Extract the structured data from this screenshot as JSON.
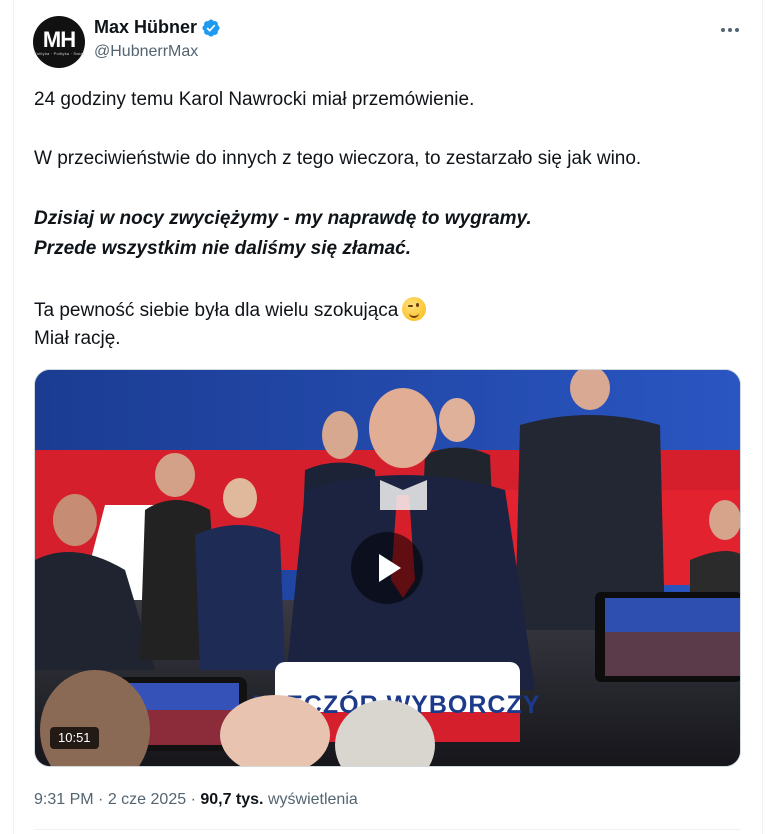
{
  "author": {
    "avatar_text": "MH",
    "avatar_subtext": "Polityka · Polityka · Świat",
    "name": "Max Hübner",
    "handle": "@HubnerrMax",
    "verified": true
  },
  "tweet": {
    "line1": "24 godziny temu Karol Nawrocki miał przemówienie.",
    "line2": "W przeciwieństwie do innych z tego wieczora, to zestarzało się jak wino.",
    "quote1": "Dzisiaj w nocy zwyciężymy - my naprawdę to wygramy.",
    "quote2": "Przede wszystkim nie daliśmy się złamać.",
    "line3": "Ta pewność siebie była dla wielu szokująca",
    "emoji": "winking-face",
    "line4": "Miał rację."
  },
  "media": {
    "duration": "10:51",
    "banner_text": "WIECZÓR WYBORCZY",
    "colors": {
      "stage_blue": "#1e3f94",
      "stage_red": "#d61f2c"
    }
  },
  "meta": {
    "time": "9:31 PM",
    "separator": "·",
    "date": "2 cze 2025",
    "views_count": "90,7 tys.",
    "views_label": "wyświetlenia"
  },
  "colors": {
    "verified_blue": "#1d9bf0",
    "secondary_text": "#536471"
  }
}
